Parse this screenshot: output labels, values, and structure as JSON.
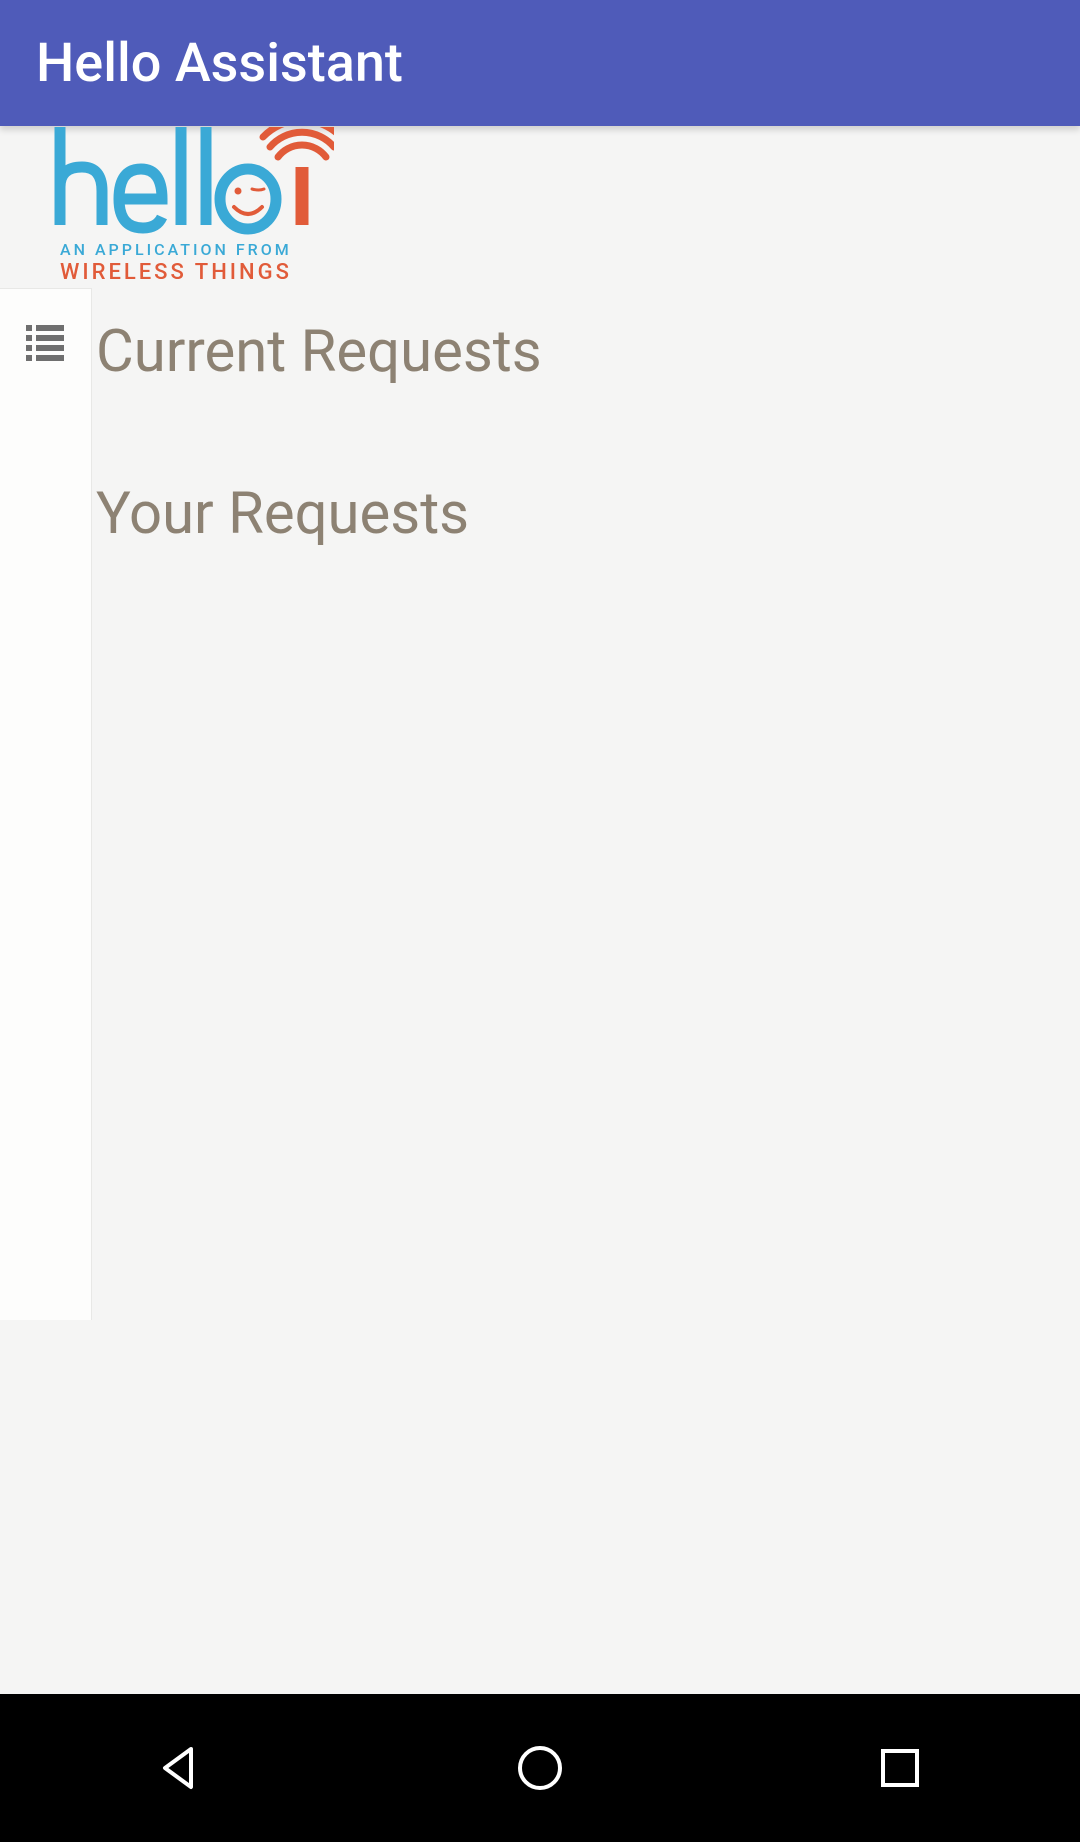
{
  "appBar": {
    "title": "Hello Assistant"
  },
  "logo": {
    "word": "hello",
    "tagline1": "AN APPLICATION FROM",
    "tagline2": "WIRELESS THINGS"
  },
  "sidebar": {
    "menuIcon": "list-icon"
  },
  "main": {
    "heading1": "Current Requests",
    "heading2": "Your Requests"
  },
  "nav": {
    "back": "back",
    "home": "home",
    "recent": "recent"
  }
}
